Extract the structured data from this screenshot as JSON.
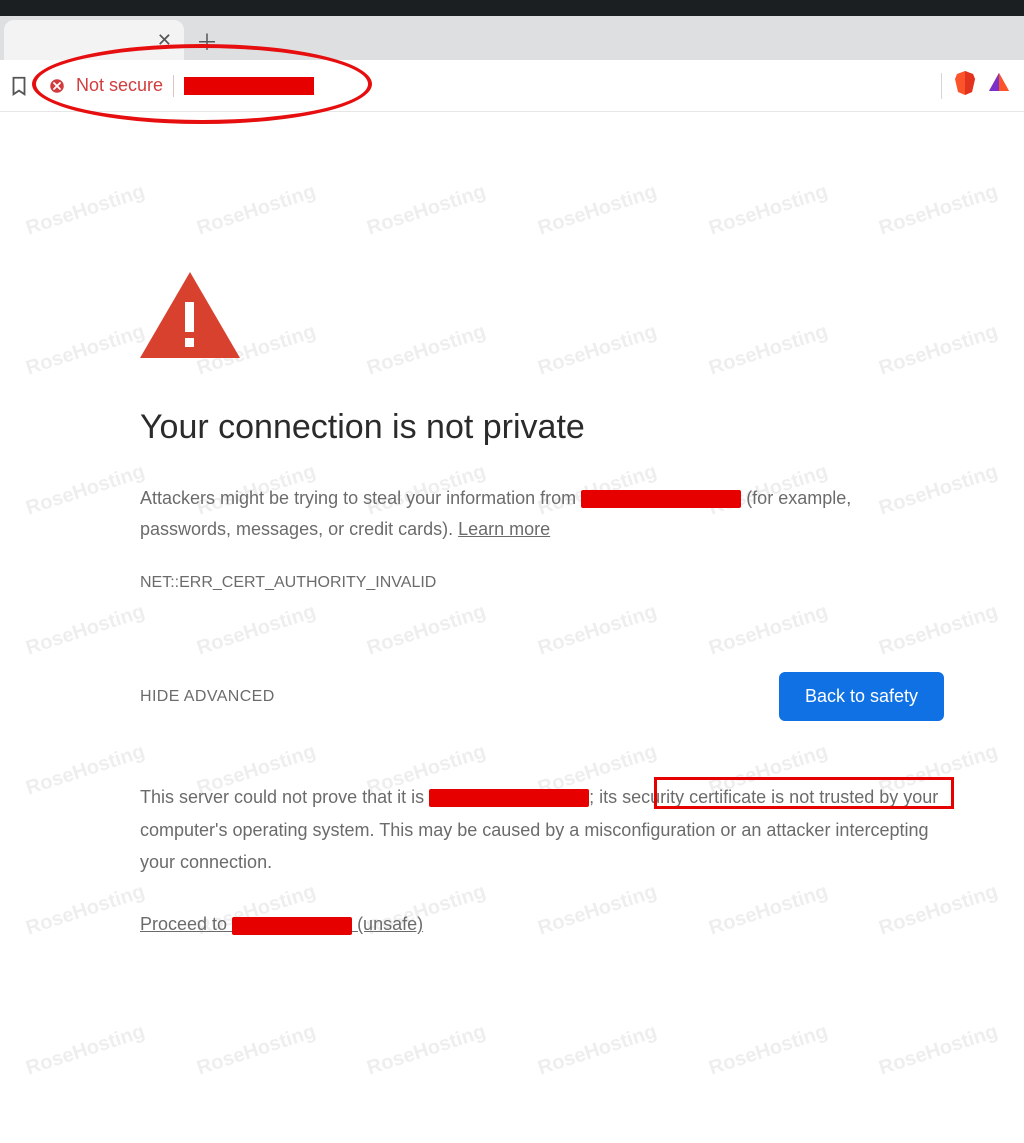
{
  "watermark_text": "RoseHosting",
  "address_bar": {
    "not_secure_label": "Not secure"
  },
  "page": {
    "heading": "Your connection is not private",
    "paragraph_before": "Attackers might be trying to steal your information from ",
    "paragraph_after": " (for example, passwords, messages, or credit cards). ",
    "learn_more": "Learn more",
    "error_code": "NET::ERR_CERT_AUTHORITY_INVALID",
    "hide_advanced": "HIDE ADVANCED",
    "back_to_safety": "Back to safety",
    "advanced_before": "This server could not prove that it is ",
    "advanced_mid": "; its ",
    "advanced_highlight": "security certificate is not trusted",
    "advanced_after": " by your computer's operating system. This may be caused by a misconfiguration or an attacker intercepting your connection.",
    "proceed_before": "Proceed to ",
    "proceed_after": " (unsafe)"
  }
}
